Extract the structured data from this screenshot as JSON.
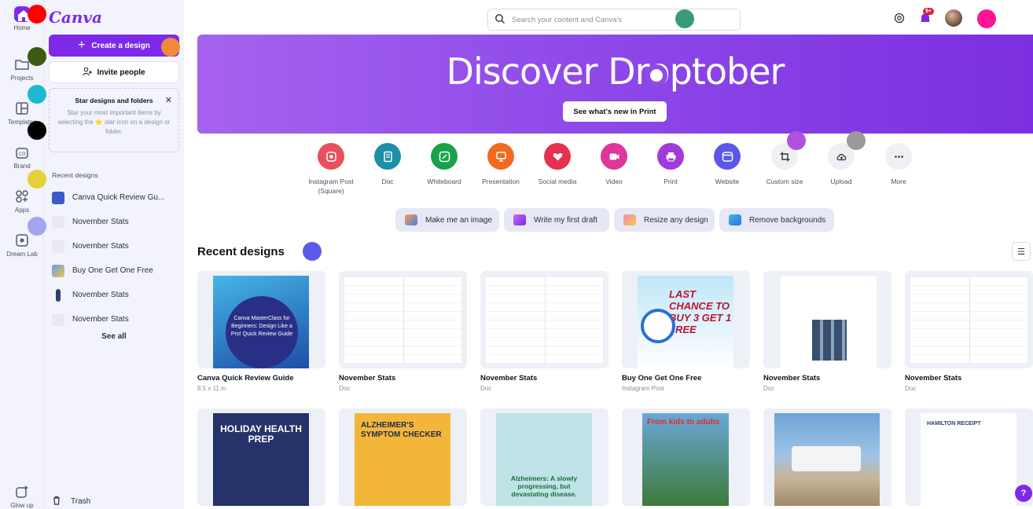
{
  "rail": {
    "items": [
      {
        "label": "Home",
        "icon": "home-icon"
      },
      {
        "label": "Projects",
        "icon": "folder-icon"
      },
      {
        "label": "Templates",
        "icon": "templates-icon"
      },
      {
        "label": "Brand",
        "icon": "brand-icon"
      },
      {
        "label": "Apps",
        "icon": "apps-icon"
      },
      {
        "label": "Dream Lab",
        "icon": "dream-lab-icon"
      },
      {
        "label": "Glow up",
        "icon": "glow-up-icon"
      }
    ]
  },
  "panel": {
    "logo": "Canva",
    "create_label": "Create a design",
    "invite_label": "Invite people",
    "star_box": {
      "title": "Star designs and folders",
      "desc": "Star your most important items by selecting the ⭐ star icon on a design or folder."
    },
    "recent_heading": "Recent designs",
    "recent_items": [
      "Canva Quick Review Gu...",
      "November Stats",
      "November Stats",
      "Buy One Get One Free",
      "November Stats",
      "November Stats"
    ],
    "see_all": "See all",
    "trash": "Trash"
  },
  "topbar": {
    "search_placeholder": "Search your content and Canva's",
    "notification_badge": "9+"
  },
  "hero": {
    "title": "Discover Droptober",
    "button_label": "See what's new in Print",
    "color": "#8f4ae9"
  },
  "shortcuts": [
    {
      "label": "Instagram Post (Square)",
      "color": "#e8505b",
      "icon": "instagram-icon"
    },
    {
      "label": "Doc",
      "color": "#1d8fa6",
      "icon": "doc-icon"
    },
    {
      "label": "Whiteboard",
      "color": "#17a34a",
      "icon": "whiteboard-icon"
    },
    {
      "label": "Presentation",
      "color": "#f26a21",
      "icon": "presentation-icon"
    },
    {
      "label": "Social media",
      "color": "#e5304f",
      "icon": "heart-icon"
    },
    {
      "label": "Video",
      "color": "#e0359b",
      "icon": "video-icon"
    },
    {
      "label": "Print",
      "color": "#a13ad8",
      "icon": "print-icon"
    },
    {
      "label": "Website",
      "color": "#5b57e8",
      "icon": "website-icon"
    },
    {
      "label": "Custom size",
      "color": "#eef0f5",
      "icon": "crop-icon"
    },
    {
      "label": "Upload",
      "color": "#eef0f5",
      "icon": "cloud-upload-icon"
    },
    {
      "label": "More",
      "color": "#eef0f5",
      "icon": "more-icon"
    }
  ],
  "magic": [
    {
      "label": "Make me an image"
    },
    {
      "label": "Write my first draft"
    },
    {
      "label": "Resize any design"
    },
    {
      "label": "Remove backgrounds"
    }
  ],
  "section_title": "Recent designs",
  "designs_row1": [
    {
      "title": "Canva Quick Review Guide",
      "sub": "8.5 x 11 in",
      "thumb_text": "Canva MasterClass for Beginners: Design Like a Pro! Quick Review Guide"
    },
    {
      "title": "November Stats",
      "sub": "Doc"
    },
    {
      "title": "November Stats",
      "sub": "Doc"
    },
    {
      "title": "Buy One Get One Free",
      "sub": "Instagram Post",
      "thumb_text": "LAST CHANCE TO BUY 3 GET 1 FREE"
    },
    {
      "title": "November Stats",
      "sub": "Doc"
    },
    {
      "title": "November Stats",
      "sub": "Doc"
    }
  ],
  "designs_row2": [
    {
      "thumb_text": "HOLIDAY HEALTH PREP"
    },
    {
      "thumb_text": "ALZHEIMER'S SYMPTOM CHECKER"
    },
    {
      "thumb_text": "Alzheimers: A slowly progressing, but devastating disease."
    },
    {
      "thumb_text": "From kids to adults"
    },
    {
      "thumb_text": ""
    },
    {
      "thumb_text": "HAMILTON RECEIPT"
    }
  ],
  "help_label": "?"
}
